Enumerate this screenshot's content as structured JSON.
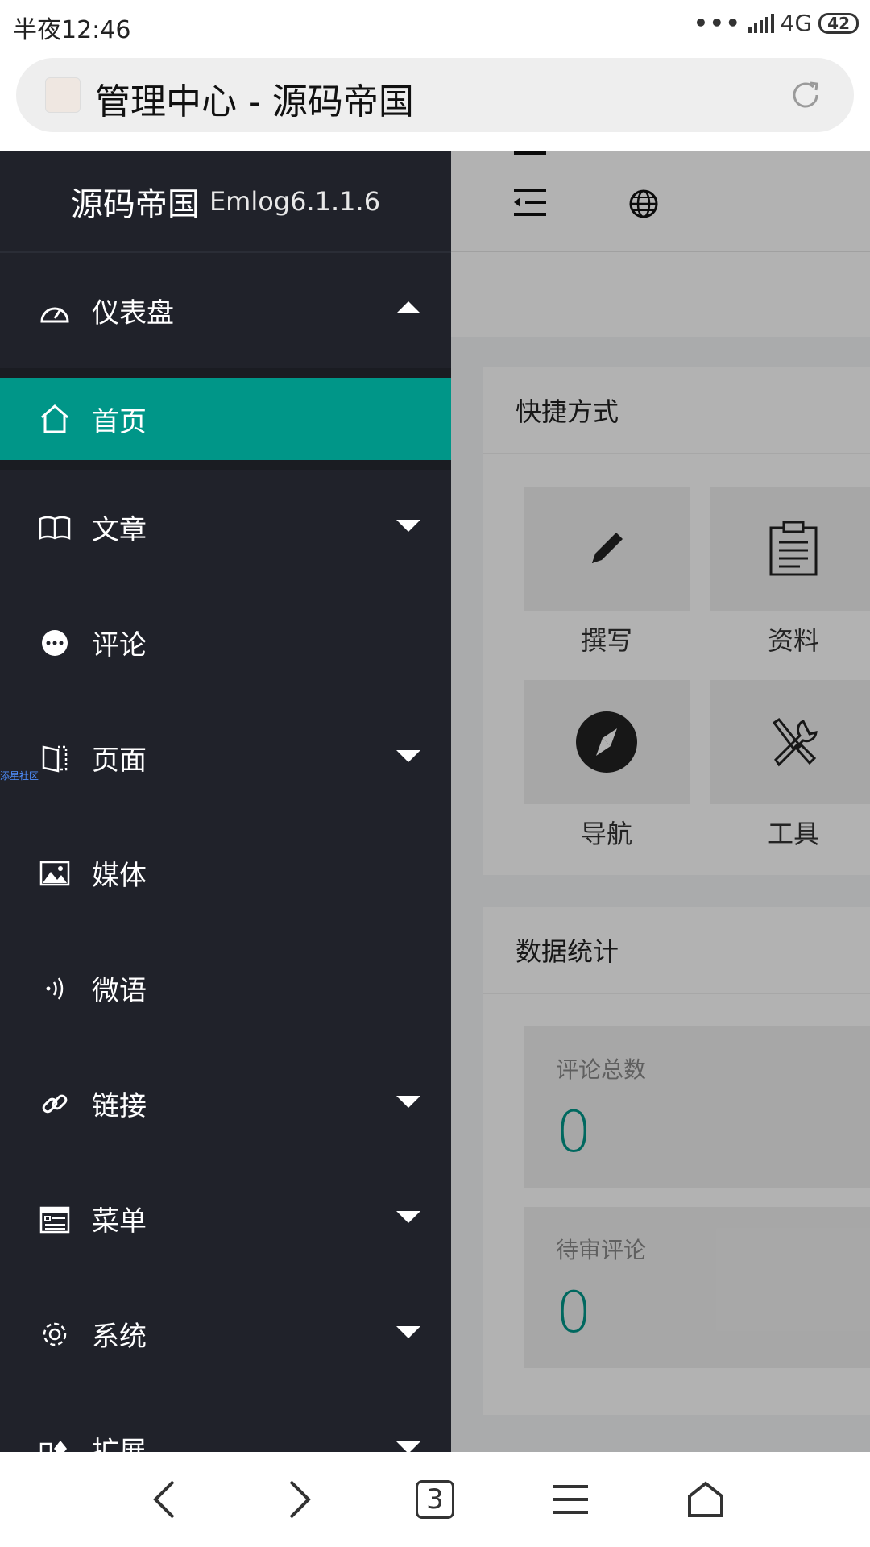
{
  "status": {
    "time": "半夜12:46",
    "network": "4G",
    "battery": "42"
  },
  "browser": {
    "page_title": "管理中心 - 源码帝国",
    "tab_count": "3"
  },
  "sidebar": {
    "brand_name": "源码帝国",
    "version": "Emlog6.1.1.6",
    "watermark": "添星社区",
    "dashboard": {
      "label": "仪表盘",
      "icon": "dashboard-icon",
      "expanded": true
    },
    "home": {
      "label": "首页",
      "icon": "home-icon",
      "active": true
    },
    "items": [
      {
        "label": "文章",
        "icon": "book-icon",
        "has_submenu": true
      },
      {
        "label": "评论",
        "icon": "comment-icon",
        "has_submenu": false
      },
      {
        "label": "页面",
        "icon": "page-icon",
        "has_submenu": true
      },
      {
        "label": "媒体",
        "icon": "image-icon",
        "has_submenu": false
      },
      {
        "label": "微语",
        "icon": "broadcast-icon",
        "has_submenu": false
      },
      {
        "label": "链接",
        "icon": "link-icon",
        "has_submenu": true
      },
      {
        "label": "菜单",
        "icon": "menu-icon",
        "has_submenu": true
      },
      {
        "label": "系统",
        "icon": "gear-icon",
        "has_submenu": true
      },
      {
        "label": "扩展",
        "icon": "extend-icon",
        "has_submenu": true
      }
    ]
  },
  "main": {
    "shortcuts": {
      "title": "快捷方式",
      "tiles": [
        {
          "label": "撰写",
          "icon": "pencil-icon"
        },
        {
          "label": "资料",
          "icon": "clipboard-icon"
        },
        {
          "label": "导航",
          "icon": "compass-icon"
        },
        {
          "label": "工具",
          "icon": "tools-icon"
        }
      ]
    },
    "stats": {
      "title": "数据统计",
      "items": [
        {
          "label": "评论总数",
          "value": "0"
        },
        {
          "label": "待审评论",
          "value": "0"
        }
      ]
    }
  },
  "colors": {
    "sidebar_bg": "#20222a",
    "accent": "#009688",
    "overlay": "rgba(0,0,0,0.30)"
  }
}
